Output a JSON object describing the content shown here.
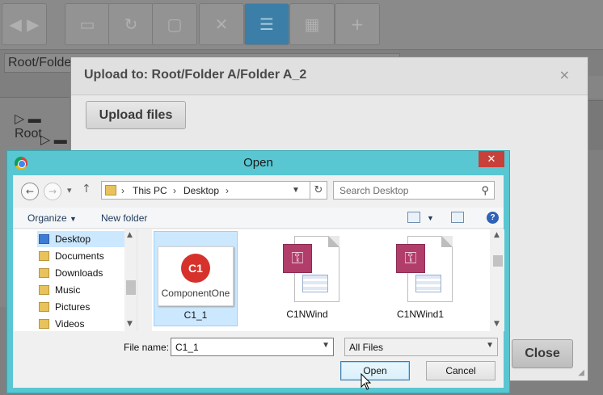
{
  "app": {
    "path": "Root/Folder A/Folder A_2",
    "tree": {
      "root_label": "Root"
    }
  },
  "upload_modal": {
    "title": "Upload to: Root/Folder A/Folder A_2",
    "close_glyph": "×",
    "upload_button": "Upload files",
    "close_button": "Close"
  },
  "open_dialog": {
    "title": "Open",
    "close_glyph": "✕",
    "breadcrumb": [
      "This PC",
      "Desktop"
    ],
    "search_placeholder": "Search Desktop",
    "organize_label": "Organize",
    "new_folder_label": "New folder",
    "nav_items": [
      {
        "label": "Desktop",
        "selected": true,
        "icon": "blue-folder-icon"
      },
      {
        "label": "Documents",
        "icon": "documents-icon"
      },
      {
        "label": "Downloads",
        "icon": "downloads-icon"
      },
      {
        "label": "Music",
        "icon": "music-icon"
      },
      {
        "label": "Pictures",
        "icon": "pictures-icon"
      },
      {
        "label": "Videos",
        "icon": "videos-icon"
      }
    ],
    "files": [
      {
        "label": "C1_1",
        "selected": true,
        "thumb": "C1",
        "brand": "ComponentOne"
      },
      {
        "label": "C1NWind"
      },
      {
        "label": "C1NWind1"
      }
    ],
    "file_name_label": "File name:",
    "file_name_value": "C1_1",
    "file_type_value": "All Files",
    "open_button": "Open",
    "cancel_button": "Cancel"
  },
  "colors": {
    "dialog_frame": "#58c7d2",
    "selection": "#cce8ff",
    "close_red": "#c7403a",
    "c1_red": "#d6312b",
    "access_key": "#b13d6b"
  }
}
